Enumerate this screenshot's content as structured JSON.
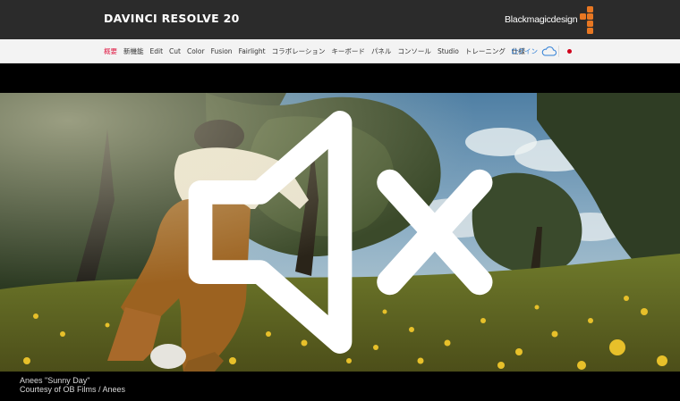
{
  "header": {
    "product_title": "DAVINCI RESOLVE 20",
    "brand_name": "Blackmagicdesign",
    "brand_color": "#e87722"
  },
  "nav": {
    "items": [
      {
        "label": "概要",
        "active": true
      },
      {
        "label": "新機能"
      },
      {
        "label": "Edit"
      },
      {
        "label": "Cut"
      },
      {
        "label": "Color"
      },
      {
        "label": "Fusion"
      },
      {
        "label": "Fairlight"
      },
      {
        "label": "コラボレーション"
      },
      {
        "label": "キーボード"
      },
      {
        "label": "パネル"
      },
      {
        "label": "コンソール"
      },
      {
        "label": "Studio"
      },
      {
        "label": "トレーニング"
      },
      {
        "label": "仕様"
      }
    ],
    "login_label": "ログイン",
    "active_color": "#e0224a",
    "login_color": "#2f7fd6",
    "region_dot_color": "#d0021b"
  },
  "hero": {
    "caption_line1": "Anees \"Sunny Day\"",
    "caption_line2": "Courtesy of OB Films / Anees",
    "mute_icon": "speaker-muted-icon"
  }
}
